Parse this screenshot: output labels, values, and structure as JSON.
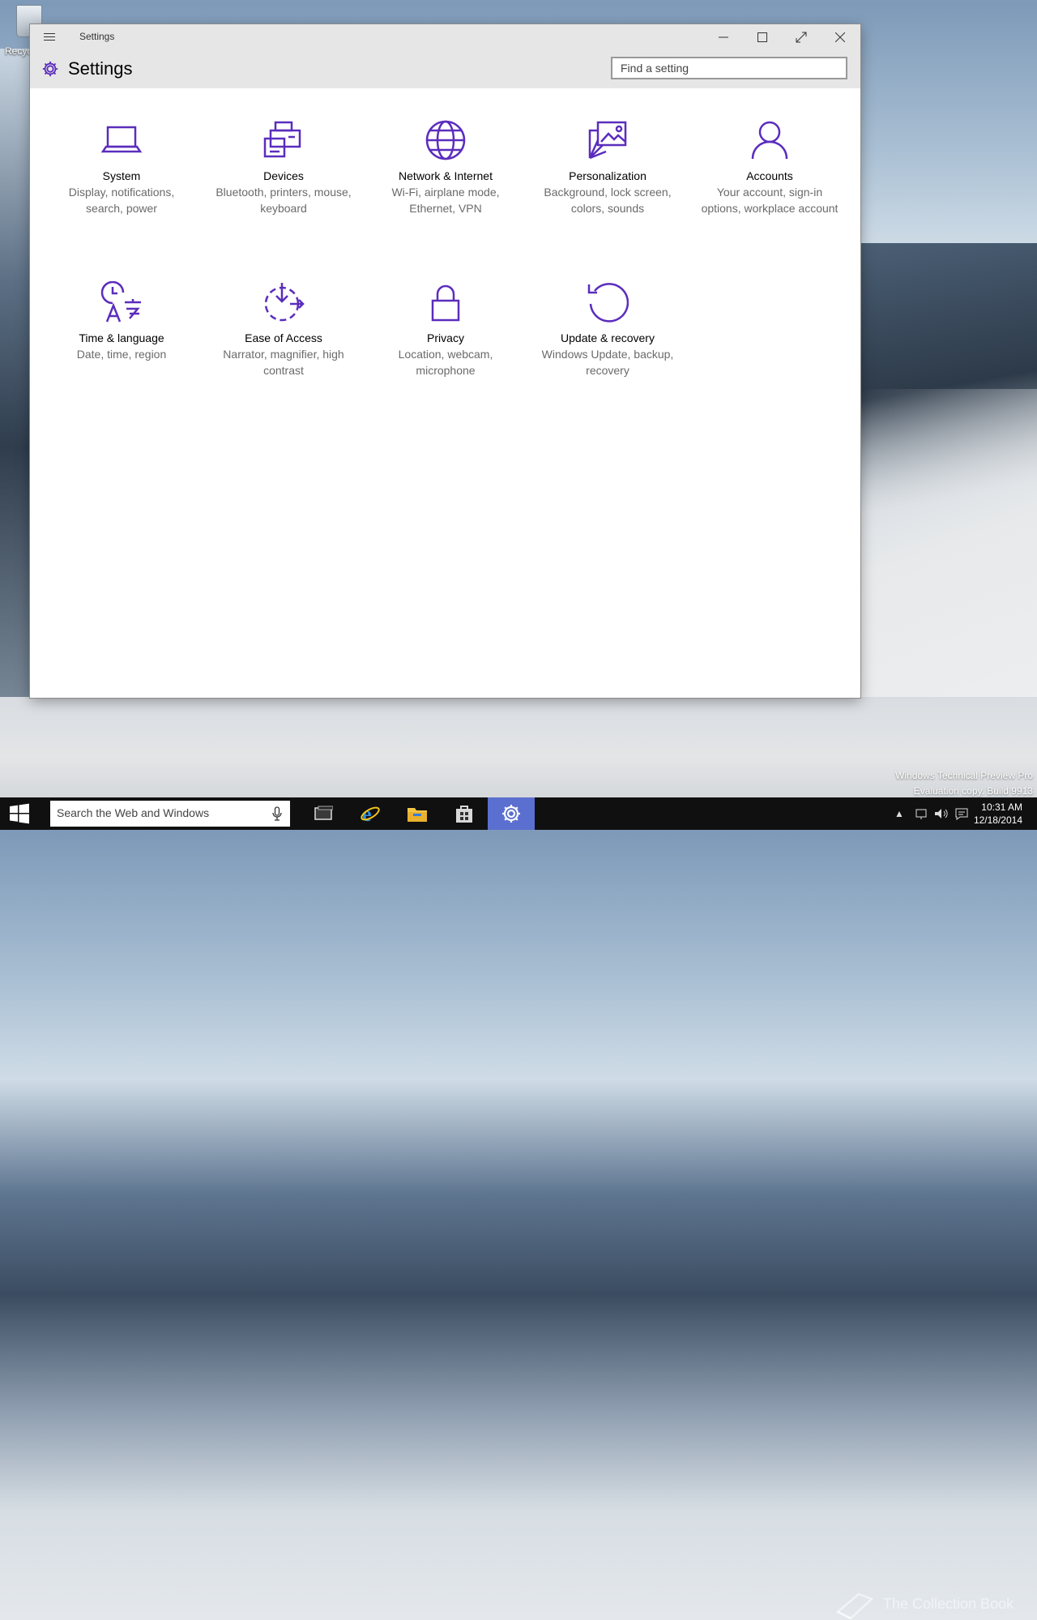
{
  "desktop": {
    "recycle_bin_label": "Recyc",
    "watermark": [
      "Windows Technical Preview Pro",
      "Evaluation copy. Build 9913"
    ],
    "overlay_text": "The Collection Book"
  },
  "window": {
    "title": "Settings",
    "heading": "Settings",
    "search_placeholder": "Find a setting",
    "accent_color": "#5b2dbd"
  },
  "categories": [
    {
      "name": "System",
      "desc": "Display, notifications, search, power",
      "icon": "laptop-icon"
    },
    {
      "name": "Devices",
      "desc": "Bluetooth, printers, mouse, keyboard",
      "icon": "devices-icon"
    },
    {
      "name": "Network & Internet",
      "desc": "Wi-Fi, airplane mode, Ethernet, VPN",
      "icon": "globe-icon"
    },
    {
      "name": "Personalization",
      "desc": "Background, lock screen, colors, sounds",
      "icon": "personalization-icon"
    },
    {
      "name": "Accounts",
      "desc": "Your account, sign-in options, workplace account",
      "icon": "person-icon"
    },
    {
      "name": "Time & language",
      "desc": "Date, time, region",
      "icon": "time-language-icon"
    },
    {
      "name": "Ease of Access",
      "desc": "Narrator, magnifier, high contrast",
      "icon": "ease-of-access-icon"
    },
    {
      "name": "Privacy",
      "desc": "Location, webcam, microphone",
      "icon": "lock-icon"
    },
    {
      "name": "Update & recovery",
      "desc": "Windows Update, backup, recovery",
      "icon": "update-icon"
    }
  ],
  "taskbar": {
    "search_placeholder": "Search the Web and Windows",
    "time": "10:31 AM",
    "date": "12/18/2014"
  }
}
